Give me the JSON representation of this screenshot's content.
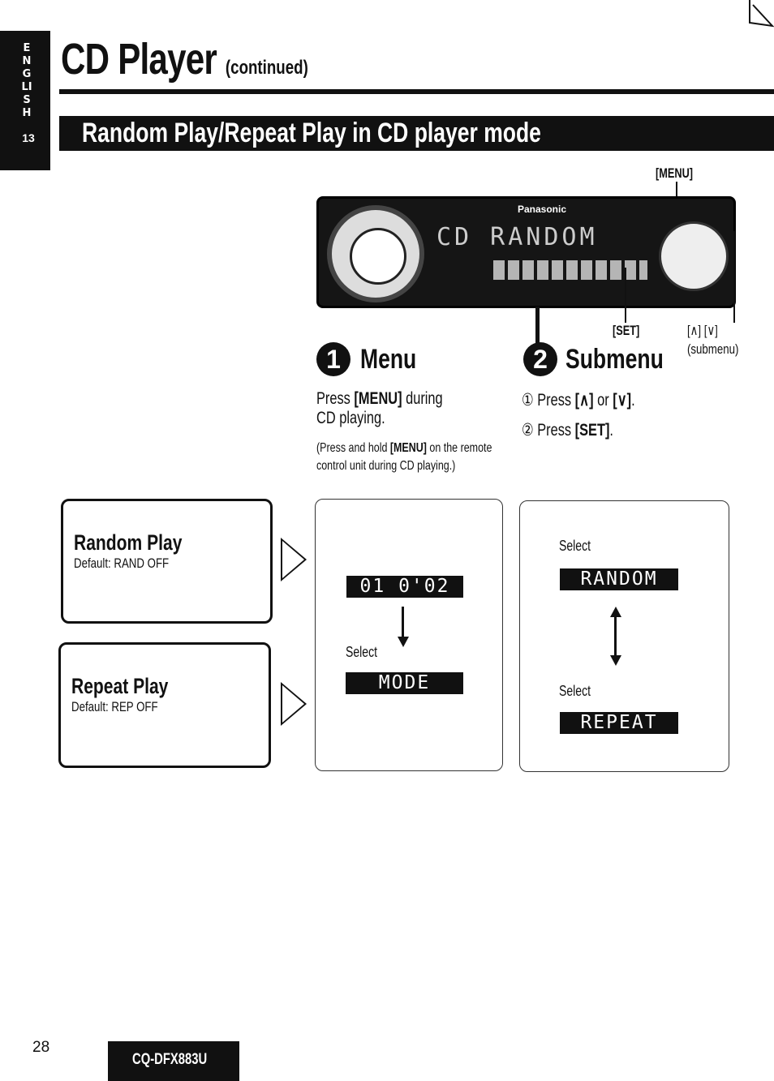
{
  "side_tab": {
    "language": "ENGLISH",
    "section_number": "13"
  },
  "title": {
    "main": "CD Player",
    "suffix": "(continued)"
  },
  "banner": "Random Play/Repeat Play in CD player mode",
  "device": {
    "callouts": {
      "menu": "[MENU]",
      "set": "[SET]",
      "updown": "[∧] [∨]",
      "updown_note": "(submenu)"
    },
    "display_text": "CD RANDOM",
    "brand": "Panasonic"
  },
  "steps": [
    {
      "number": "1",
      "heading": "Menu",
      "instruction_prefix": "Press ",
      "instruction_key": "[MENU]",
      "instruction_suffix": " during",
      "instruction_line2": "CD playing.",
      "note_prefix": "(Press and hold ",
      "note_key": "[MENU]",
      "note_suffix": " on the remote control unit during CD playing.)"
    },
    {
      "number": "2",
      "heading": "Submenu",
      "items": [
        {
          "marker": "①",
          "text_prefix": "Press ",
          "text_key": "[∧]",
          "text_mid": " or ",
          "text_key2": "[∨]",
          "text_suffix": "."
        },
        {
          "marker": "②",
          "text_prefix": "Press ",
          "text_key": "[SET]",
          "text_suffix": "."
        }
      ]
    }
  ],
  "modes": [
    {
      "title": "Random Play",
      "default": "Default: RAND OFF"
    },
    {
      "title": "Repeat Play",
      "default": "Default: REP OFF"
    }
  ],
  "menu_panel": {
    "display_top": "01  0'02",
    "select_label": "Select",
    "display_bottom": "MODE"
  },
  "submenu_panel": {
    "select_top": "Select",
    "display_top": "RANDOM",
    "select_bottom": "Select",
    "display_bottom": "REPEAT"
  },
  "footer": {
    "page_number": "28",
    "model": "CQ-DFX883U"
  }
}
